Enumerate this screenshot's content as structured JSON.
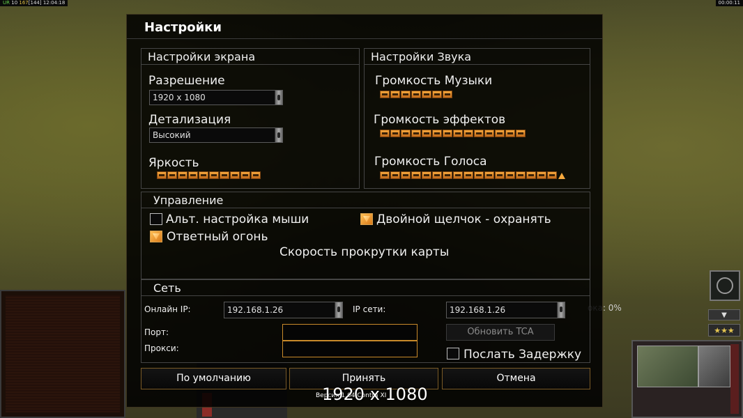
{
  "hud": {
    "left_a": "UR",
    "left_b": "10",
    "left_c": "167",
    "left_d": "[144]",
    "time_left": "12:04:18",
    "time_right": "00:00:11"
  },
  "background": {
    "right_text": "ока: 0%",
    "version": "Версия 1.04 Contra XI",
    "big_resolution": "1920 x 1080",
    "stars": "★★★",
    "down_arrow": "▼"
  },
  "dialog": {
    "title": "Настройки",
    "screen": {
      "header": "Настройки экрана",
      "resolution_label": "Разрешение",
      "resolution_value": "1920 x 1080",
      "detail_label": "Детализация",
      "detail_value": "Высокий",
      "brightness_label": "Яркость",
      "brightness_level": 0.6
    },
    "sound": {
      "header": "Настройки Звука",
      "music_label": "Громкость Музыки",
      "music_level": 0.4,
      "effects_label": "Громкость эффектов",
      "effects_level": 0.8,
      "voice_label": "Громкость Голоса",
      "voice_level": 1.0
    },
    "controls": {
      "header": "Управление",
      "alt_mouse_label": "Альт. настройка мыши",
      "alt_mouse_checked": false,
      "double_click_label": "Двойной щелчок - охранять",
      "double_click_checked": true,
      "return_fire_label": "Ответный огонь",
      "return_fire_checked": true,
      "scroll_speed_label": "Скорость прокрутки карты"
    },
    "network": {
      "header": "Сеть",
      "online_ip_label": "Онлайн IP:",
      "online_ip_value": "192.168.1.26",
      "lan_ip_label": "IP сети:",
      "lan_ip_value": "192.168.1.26",
      "port_label": "Порт:",
      "port_value": "",
      "proxy_label": "Прокси:",
      "proxy_value": "",
      "update_tca_label": "Обновить TCA",
      "send_delay_label": "Послать Задержку",
      "send_delay_checked": false
    },
    "buttons": {
      "defaults": "По умолчанию",
      "accept": "Принять",
      "cancel": "Отмена"
    }
  },
  "colors": {
    "accent": "#f6a93e",
    "border": "#7a5a26"
  }
}
